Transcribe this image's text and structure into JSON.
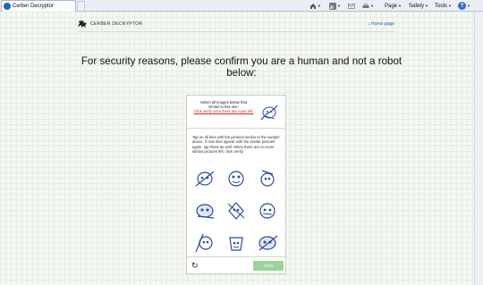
{
  "browser": {
    "tab_title": "Cerber Decryptor",
    "commands": {
      "page": "Page",
      "safety": "Safety",
      "tools": "Tools",
      "help": "?"
    },
    "icons": [
      "home-icon",
      "feeds-icon",
      "mail-icon",
      "print-icon",
      "help-icon"
    ]
  },
  "site": {
    "logo_text": "CERBER DECRYPTOR",
    "home_link": "Home page"
  },
  "headline": "For security reasons, please confirm you are a human and not a robot below:",
  "captcha": {
    "prompt_line1": "Select all images below that",
    "prompt_line2": "similar to this one:",
    "prompt_link": "Click verify once there are none left.",
    "instructions": "Tap on all tiles with the pictures similar to the sample above. If new tiles appear with the similar pictures again, tap those as well. When there are no more similar pictures left, click Verify.",
    "verify_label": "Verify",
    "tiles": [
      {
        "name": "doodle-face-1"
      },
      {
        "name": "doodle-face-2"
      },
      {
        "name": "doodle-face-3"
      },
      {
        "name": "doodle-face-4"
      },
      {
        "name": "doodle-face-5"
      },
      {
        "name": "doodle-face-6"
      },
      {
        "name": "doodle-face-7"
      },
      {
        "name": "doodle-face-8"
      },
      {
        "name": "doodle-face-9"
      }
    ],
    "accent_color": "#2a4c9a",
    "verify_color": "#9bd39a"
  }
}
